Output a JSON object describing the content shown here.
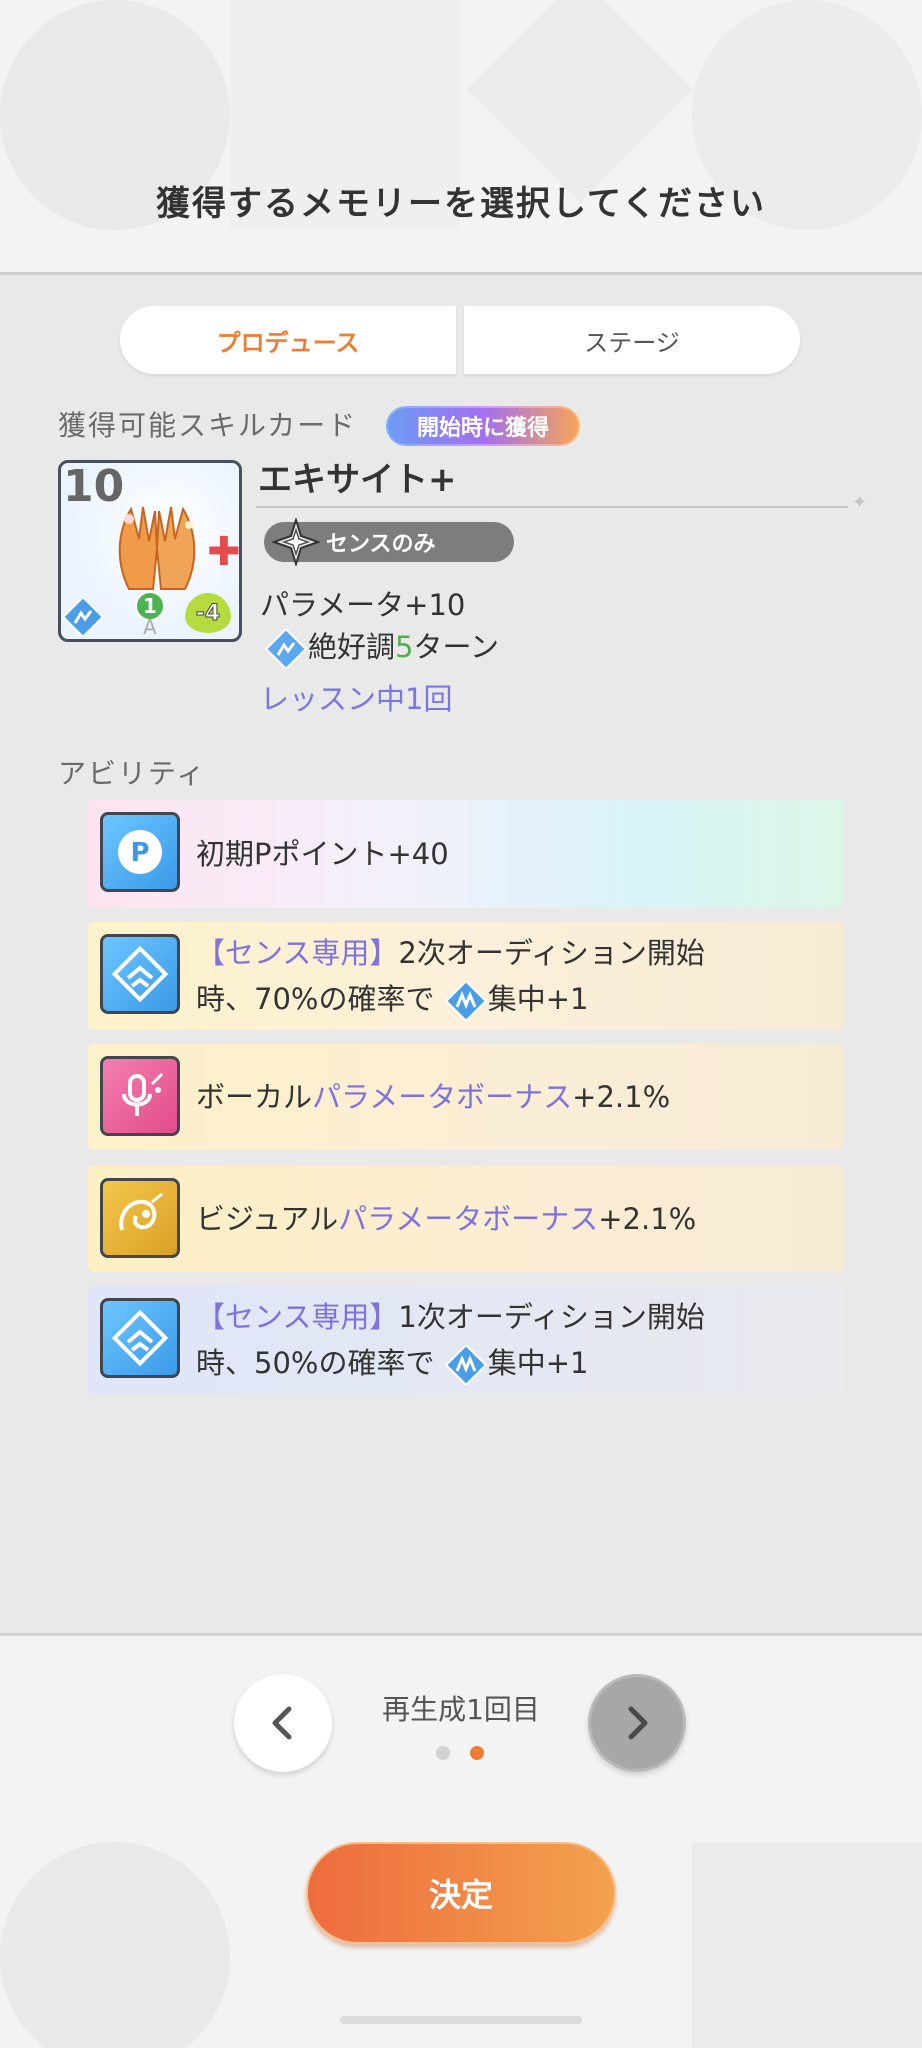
{
  "header": {
    "title": "獲得するメモリーを選択してください"
  },
  "tabs": [
    {
      "label": "プロデュース",
      "active": true
    },
    {
      "label": "ステージ",
      "active": false
    }
  ],
  "skill_section": {
    "label": "獲得可能スキルカード",
    "badge": "開始時に獲得",
    "card": {
      "level": "10",
      "name": "エキサイト+",
      "cost": "1",
      "stamina": "-4",
      "rank": "A",
      "restriction": "センスのみ",
      "effect_param_prefix": "パラメータ+",
      "effect_param_value": "10",
      "effect_buff_name": "絶好調",
      "effect_buff_turns": "5",
      "effect_buff_suffix": "ターン",
      "effect_lesson": "レッスン中1回"
    }
  },
  "ability_section": {
    "label": "アビリティ",
    "items": [
      {
        "icon": "p-point-icon",
        "text": "初期Pポイント+40"
      },
      {
        "icon": "sense-diamond-icon",
        "highlight": "【センス専用】",
        "text_a": "2次オーディション開始",
        "text_b": "時、70%の確率で",
        "buff": "集中+1"
      },
      {
        "icon": "vocal-mic-icon",
        "prefix": "ボーカル",
        "highlight": "パラメータボーナス",
        "suffix": "+2.1%"
      },
      {
        "icon": "visual-icon",
        "prefix": "ビジュアル",
        "highlight": "パラメータボーナス",
        "suffix": "+2.1%"
      },
      {
        "icon": "sense-diamond-icon",
        "highlight": "【センス専用】",
        "text_a": "1次オーディション開始",
        "text_b": "時、50%の確率で",
        "buff": "集中+1"
      }
    ]
  },
  "footer": {
    "regen_label": "再生成1回目",
    "prev_symbol": "<",
    "next_symbol": ">",
    "page_count": 2,
    "current_page": 2,
    "confirm_label": "決定"
  },
  "colors": {
    "accent_orange": "#ec7d34",
    "highlight_purple": "#7d72e0",
    "buff_green": "#4fb04f"
  }
}
